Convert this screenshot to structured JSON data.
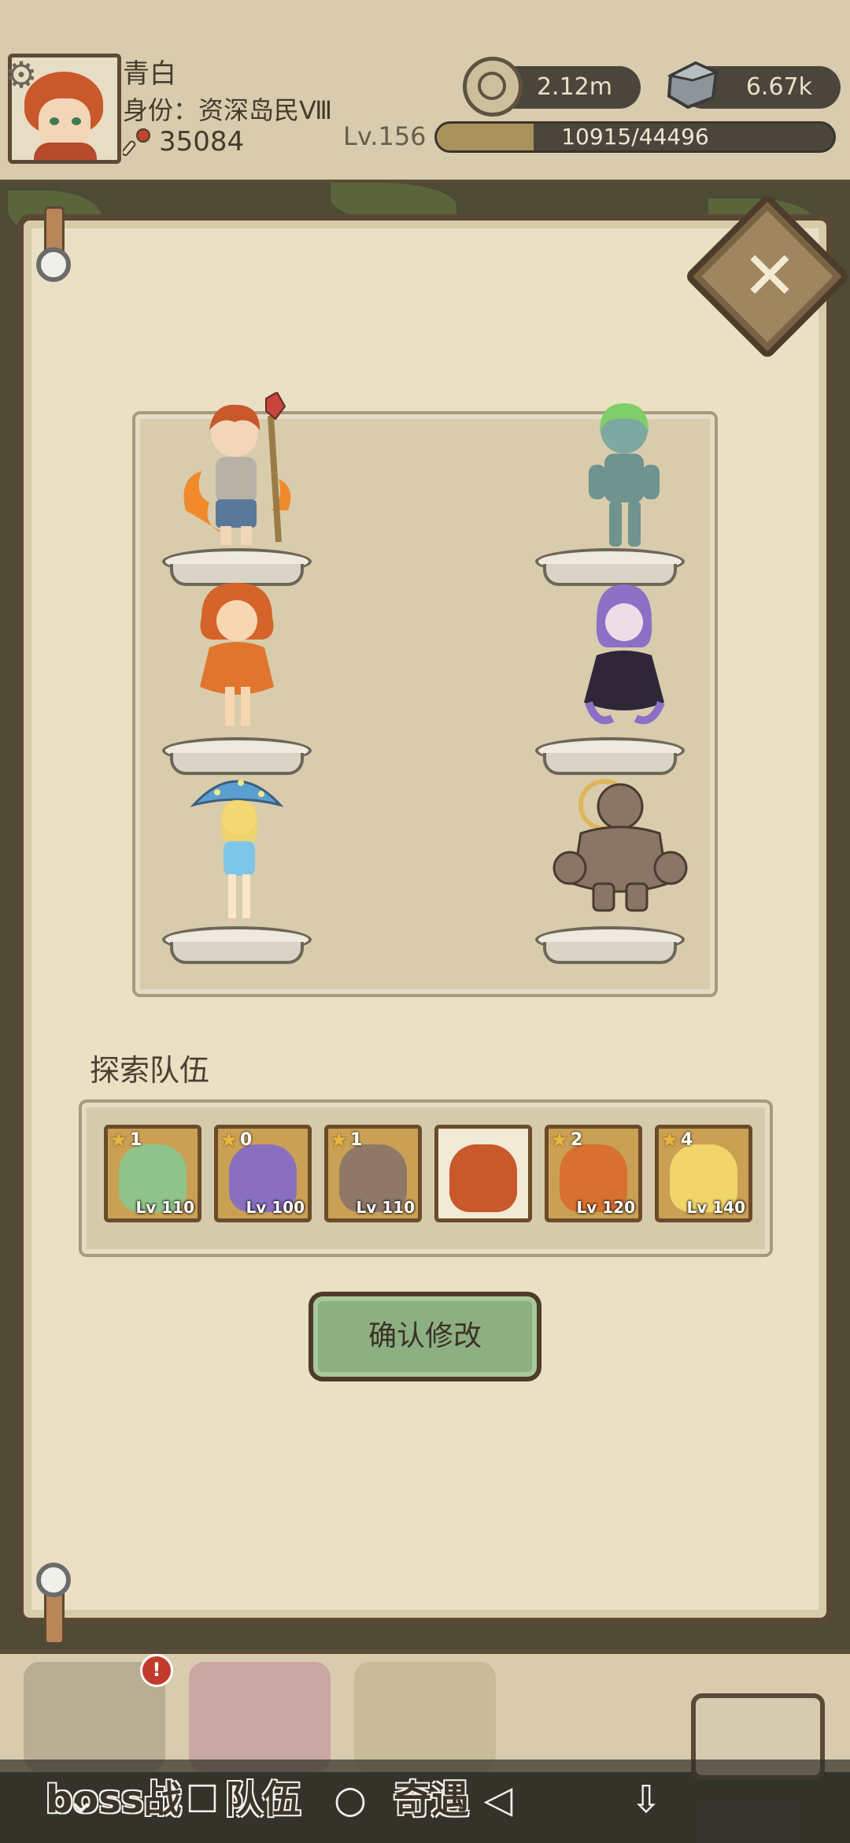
{
  "player": {
    "name": "青白",
    "title": "身份：资深岛民Ⅷ",
    "power": "35084",
    "level": "Lv.156"
  },
  "resources": {
    "coins": "2.12m",
    "stones": "6.67k"
  },
  "exp": {
    "text": "10915/44496",
    "fraction": 0.245
  },
  "team_section": {
    "title": "探索队伍"
  },
  "team": [
    {
      "stars": "1",
      "level": "Lv 110",
      "hero": "green-golem-girl",
      "color": "#8fc38a"
    },
    {
      "stars": "0",
      "level": "Lv 100",
      "hero": "purple-octopus-girl",
      "color": "#8a6fc0"
    },
    {
      "stars": "1",
      "level": "Lv 110",
      "hero": "stone-golem",
      "color": "#8f7868"
    },
    {
      "stars": "",
      "level": "",
      "hero": "red-haired-boy",
      "color": "#c9582b"
    },
    {
      "stars": "2",
      "level": "Lv 120",
      "hero": "fire-girl",
      "color": "#d8702f"
    },
    {
      "stars": "4",
      "level": "Lv 140",
      "hero": "mushroom-girl",
      "color": "#f1d46a"
    }
  ],
  "confirm_button": {
    "label": "确认修改"
  },
  "bottom_nav": {
    "boss_label": "boss战",
    "team_label": "队伍",
    "encounter_label": "奇遇",
    "badge": "!"
  },
  "colors": {
    "paper": "#eae0c4",
    "border": "#5b4834",
    "confirm": "#8db082"
  }
}
